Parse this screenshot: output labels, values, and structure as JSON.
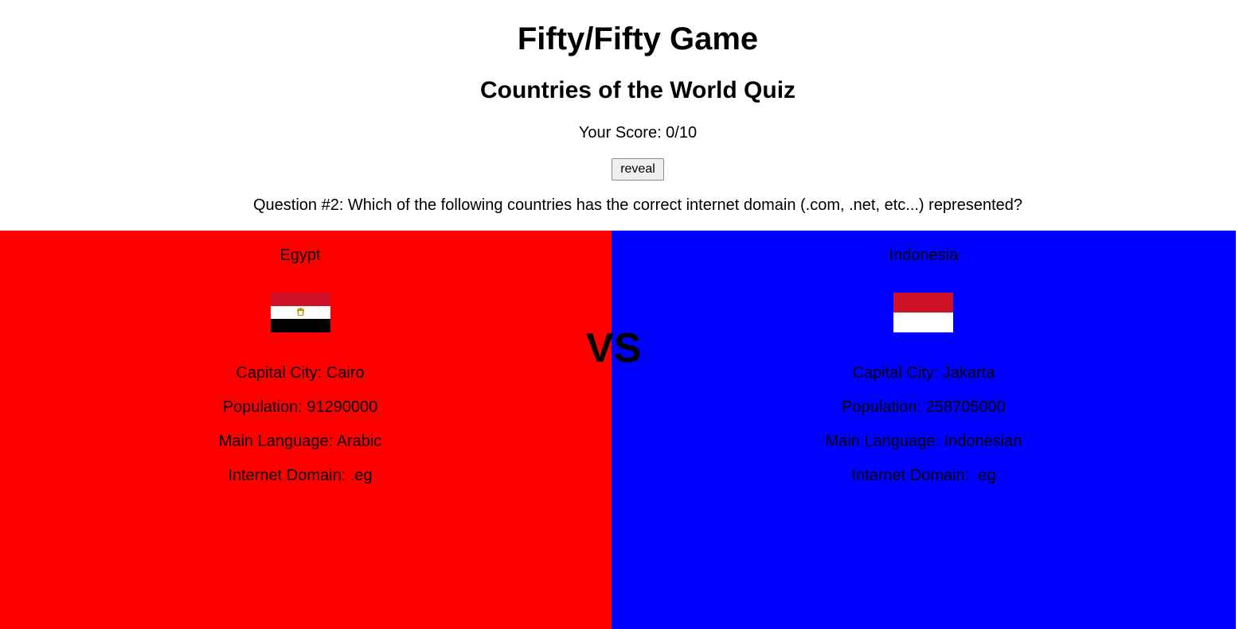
{
  "header": {
    "title": "Fifty/Fifty Game",
    "subtitle": "Countries of the World Quiz",
    "score": "Your Score: 0/10",
    "reveal_label": "reveal",
    "question": "Question #2: Which of the following countries has the correct internet domain (.com, .net, etc...) represented?"
  },
  "vs_label": "VS",
  "countries": [
    {
      "name": "Egypt",
      "flag": "egypt-flag",
      "capital": "Capital City: Cairo",
      "population": "Population: 91290000",
      "language": "Main Language: Arabic",
      "domain": "Internet Domain:  .eg",
      "panel_color": "#ff0000"
    },
    {
      "name": "Indonesia",
      "flag": "indonesia-flag",
      "capital": "Capital City: Jakarta",
      "population": "Population: 258705000",
      "language": "Main Language: Indonesian",
      "domain": "Internet Domain:  .eg",
      "panel_color": "#0000ff"
    }
  ]
}
